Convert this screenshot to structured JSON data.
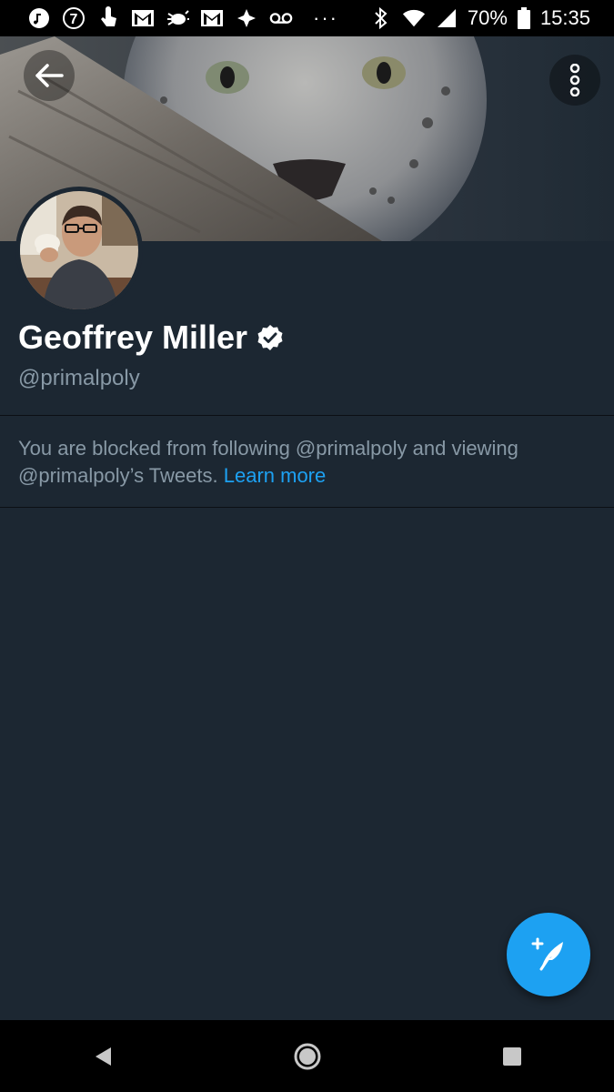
{
  "status_bar": {
    "battery": "70%",
    "time": "15:35",
    "notification_number": "7",
    "more_dots": "···"
  },
  "profile": {
    "name": "Geoffrey Miller",
    "handle": "@primalpoly",
    "blocked_message": "You are blocked from following @primalpoly and viewing @primalpoly’s Tweets.",
    "learn_more": "Learn more"
  },
  "colors": {
    "background": "#1c2732",
    "accent": "#1da1f2",
    "muted_text": "#8899a6"
  },
  "icons": {
    "back": "arrow-left-icon",
    "overflow": "more-vertical-icon",
    "verified": "verified-badge-icon",
    "compose": "compose-tweet-icon",
    "nav_back": "triangle-back-icon",
    "nav_home": "circle-home-icon",
    "nav_recents": "square-recents-icon"
  }
}
